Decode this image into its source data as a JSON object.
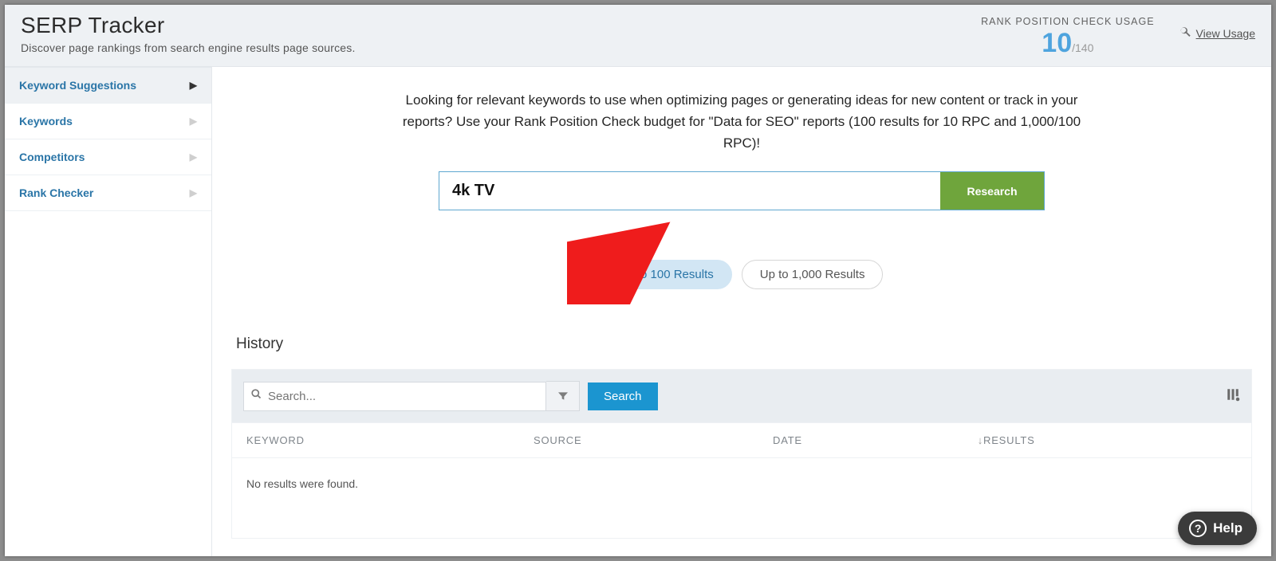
{
  "header": {
    "title": "SERP Tracker",
    "subtitle": "Discover page rankings from search engine results page sources."
  },
  "usage": {
    "label": "RANK POSITION CHECK USAGE",
    "used": "10",
    "total": "/140",
    "view_link": "View Usage"
  },
  "sidebar": {
    "items": [
      {
        "label": "Keyword Suggestions",
        "active": true
      },
      {
        "label": "Keywords",
        "active": false
      },
      {
        "label": "Competitors",
        "active": false
      },
      {
        "label": "Rank Checker",
        "active": false
      }
    ]
  },
  "main": {
    "intro": "Looking for relevant keywords to use when optimizing pages or generating ideas for new content or track in your reports? Use your Rank Position Check budget for \"Data for SEO\" reports (100 results for 10 RPC and 1,000/100 RPC)!",
    "search_value": "4k TV",
    "research_btn": "Research",
    "chips": {
      "opt100": "Up to 100 Results",
      "opt1000": "Up to 1,000 Results"
    }
  },
  "history": {
    "title": "History",
    "search_placeholder": "Search...",
    "search_btn": "Search",
    "columns": {
      "keyword": "KEYWORD",
      "source": "SOURCE",
      "date": "DATE",
      "sort_arrow": "↓",
      "results": "RESULTS"
    },
    "empty": "No results were found."
  },
  "help": {
    "label": "Help"
  }
}
